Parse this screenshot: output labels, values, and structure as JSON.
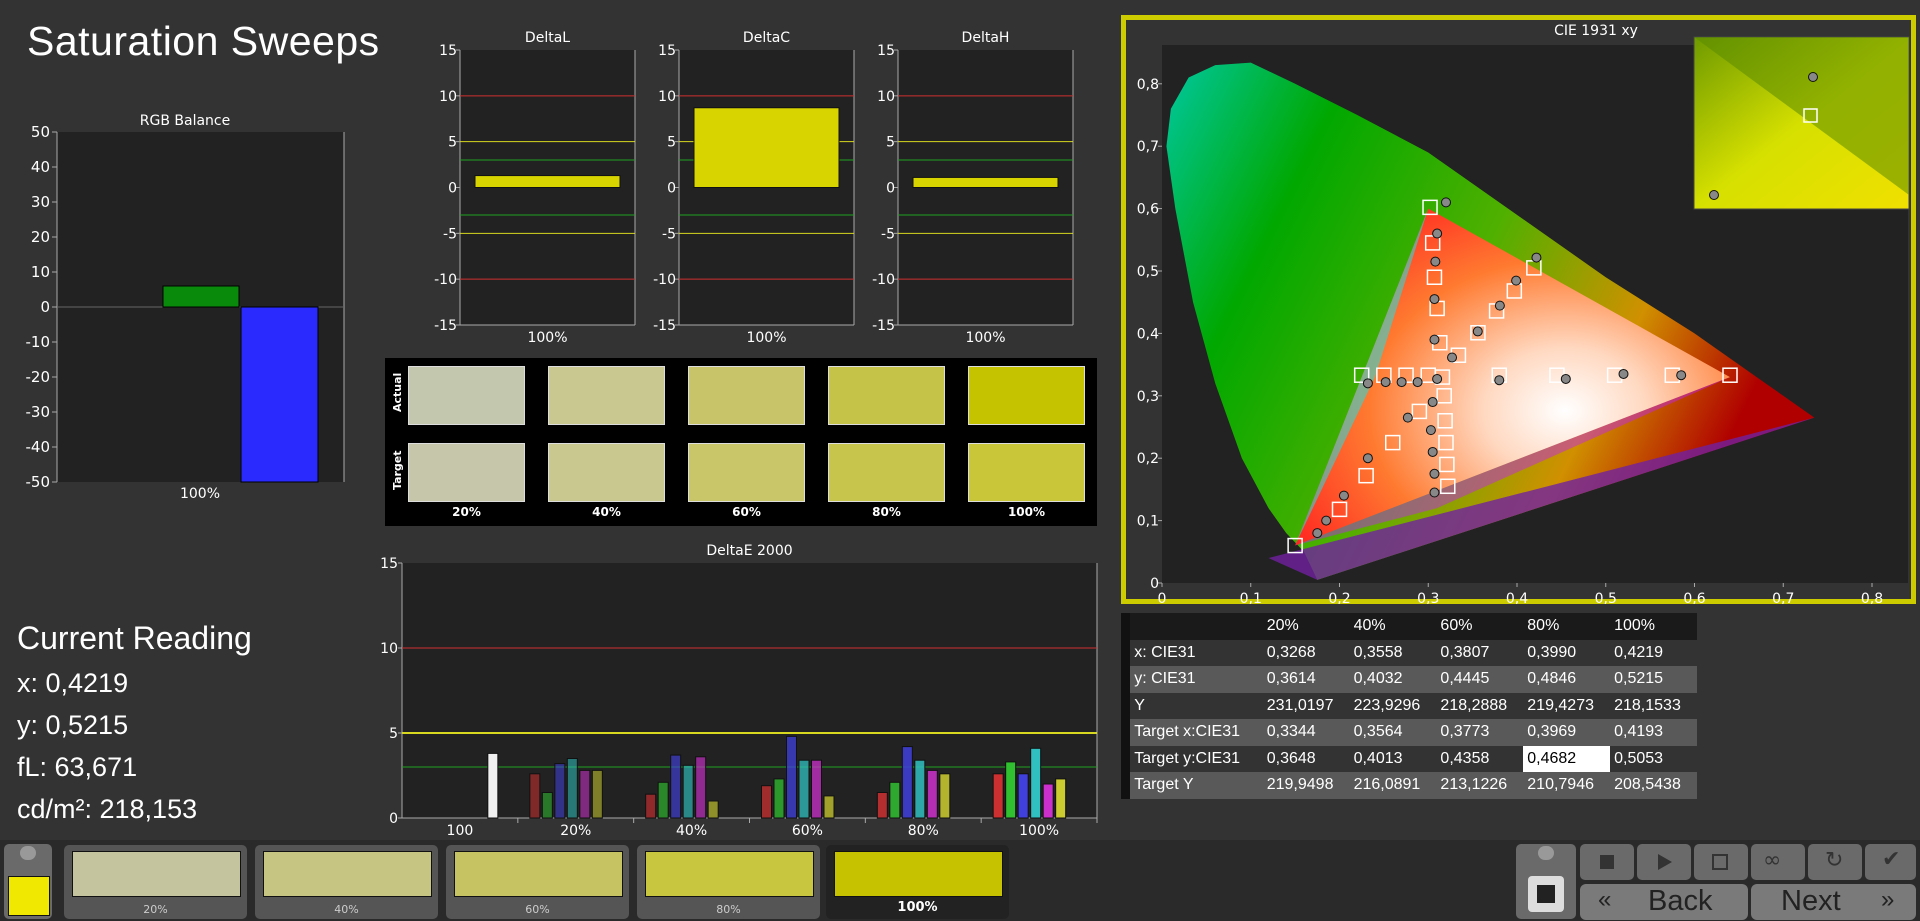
{
  "title": "Saturation Sweeps",
  "rgb_balance": {
    "title": "RGB Balance",
    "yticks": [
      "50",
      "40",
      "30",
      "20",
      "10",
      "0",
      "-10",
      "-20",
      "-30",
      "-40",
      "-50"
    ],
    "category": "100%",
    "green": 6,
    "blue": -50,
    "colors": {
      "green": "#0a8a0a",
      "blue": "#2a2aff"
    }
  },
  "delta_l": {
    "title": "DeltaL",
    "value": 1.3,
    "category": "100%"
  },
  "delta_c": {
    "title": "DeltaC",
    "value": 8.7,
    "category": "100%"
  },
  "delta_h": {
    "title": "DeltaH",
    "value": 1.1,
    "category": "100%"
  },
  "delta_yticks": [
    "15",
    "10",
    "5",
    "0",
    "-5",
    "-10",
    "-15"
  ],
  "swatches": {
    "actual_label": "Actual",
    "target_label": "Target",
    "labels": [
      "20%",
      "40%",
      "60%",
      "80%",
      "100%"
    ],
    "actual": [
      "#c3c7ae",
      "#c8c890",
      "#c8c46a",
      "#c5c448",
      "#c5c200"
    ],
    "target": [
      "#c6c6ab",
      "#c9c88e",
      "#c9c669",
      "#c8c54c",
      "#c9c63a"
    ]
  },
  "delta_e": {
    "title": "DeltaE 2000",
    "yticks": [
      "15",
      "10",
      "5",
      "0"
    ],
    "groups": [
      "100",
      "20%",
      "40%",
      "60%",
      "80%",
      "100%"
    ],
    "bars": [
      [
        3.8
      ],
      [
        2.6,
        1.5,
        3.2,
        3.5,
        2.8,
        2.8
      ],
      [
        1.4,
        2.1,
        3.7,
        3.1,
        3.6,
        1.0
      ],
      [
        1.9,
        2.3,
        4.8,
        3.4,
        3.4,
        1.3
      ],
      [
        1.5,
        2.1,
        4.2,
        3.4,
        2.8,
        2.6
      ],
      [
        2.6,
        3.3,
        2.6,
        4.1,
        2.0,
        2.3
      ]
    ],
    "bar_colors": [
      "#cc3030",
      "#30c030",
      "#4040dd",
      "#30c0c0",
      "#cc30cc",
      "#cccc30"
    ]
  },
  "cie": {
    "title": "CIE 1931 xy",
    "xticks": [
      "0",
      "0,1",
      "0,2",
      "0,3",
      "0,4",
      "0,5",
      "0,6",
      "0,7",
      "0,8"
    ],
    "yticks": [
      "0",
      "0,1",
      "0,2",
      "0,3",
      "0,4",
      "0,5",
      "0,6",
      "0,7",
      "0,8"
    ]
  },
  "current": {
    "heading": "Current Reading",
    "x": "x: 0,4219",
    "y": "y: 0,5215",
    "fl": "fL: 63,671",
    "cdm2": "cd/m²: 218,153"
  },
  "table": {
    "headers": [
      "",
      "20%",
      "40%",
      "60%",
      "80%",
      "100%"
    ],
    "rows": [
      [
        "x: CIE31",
        "0,3268",
        "0,3558",
        "0,3807",
        "0,3990",
        "0,4219"
      ],
      [
        "y: CIE31",
        "0,3614",
        "0,4032",
        "0,4445",
        "0,4846",
        "0,5215"
      ],
      [
        "Y",
        "231,0197",
        "223,9296",
        "218,2888",
        "219,4273",
        "218,1533"
      ],
      [
        "Target x:CIE31",
        "0,3344",
        "0,3564",
        "0,3773",
        "0,3969",
        "0,4193"
      ],
      [
        "Target y:CIE31",
        "0,3648",
        "0,4013",
        "0,4358",
        "0,4682",
        "0,5053"
      ],
      [
        "Target Y",
        "219,9498",
        "216,0891",
        "213,1226",
        "210,7946",
        "208,5438"
      ]
    ]
  },
  "thumbnails": {
    "labels": [
      "20%",
      "40%",
      "60%",
      "80%",
      "100%"
    ],
    "colors": [
      "#c4c59e",
      "#c6c582",
      "#c6c462",
      "#c8c63e",
      "#c6c200"
    ]
  },
  "current_swatch_color": "#f0e800",
  "buttons": {
    "back": "Back",
    "next": "Next"
  },
  "accent": "#c8c800"
}
